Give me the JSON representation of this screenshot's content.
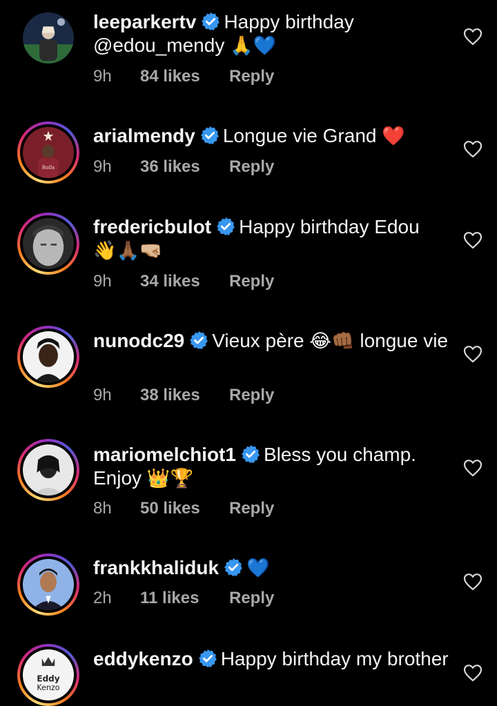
{
  "comments": [
    {
      "username": "leeparkertv",
      "verified": true,
      "text": "Happy birthday @edou_mendy",
      "emojis": [
        "🙏",
        "💙"
      ],
      "time": "9h",
      "likes": "84 likes",
      "reply": "Reply",
      "has_story": false
    },
    {
      "username": "arialmendy",
      "verified": true,
      "text": "Longue vie Grand",
      "emojis": [
        "❤️"
      ],
      "time": "9h",
      "likes": "36 likes",
      "reply": "Reply",
      "has_story": true
    },
    {
      "username": "fredericbulot",
      "verified": true,
      "text": "Happy birthday Edou",
      "emojis": [
        "👋",
        "🙏🏾",
        "🤜🏼"
      ],
      "time": "9h",
      "likes": "34 likes",
      "reply": "Reply",
      "has_story": true
    },
    {
      "username": "nunodc29",
      "verified": true,
      "text_before": "Vieux père",
      "emojis": [
        "😂",
        "👊🏾"
      ],
      "text_after": "longue vie",
      "time": "9h",
      "likes": "38 likes",
      "reply": "Reply",
      "has_story": true
    },
    {
      "username": "mariomelchiot1",
      "verified": true,
      "text": "Bless you champ. Enjoy",
      "emojis": [
        "👑",
        "🏆"
      ],
      "time": "8h",
      "likes": "50 likes",
      "reply": "Reply",
      "has_story": true
    },
    {
      "username": "frankkhaliduk",
      "verified": true,
      "text": "",
      "emojis": [
        "💙"
      ],
      "time": "2h",
      "likes": "11 likes",
      "reply": "Reply",
      "has_story": true
    },
    {
      "username": "eddykenzo",
      "verified": true,
      "text": "Happy birthday my brother",
      "emojis": [],
      "has_story": true,
      "avatar_text": "Eddy Kenzo"
    }
  ],
  "colors": {
    "background": "#000000",
    "text": "#f5f5f5",
    "meta": "#a8a8a8",
    "verified_badge": "#3897f0"
  },
  "icons": {
    "verified": "verified-badge-icon",
    "like": "heart-outline-icon"
  }
}
